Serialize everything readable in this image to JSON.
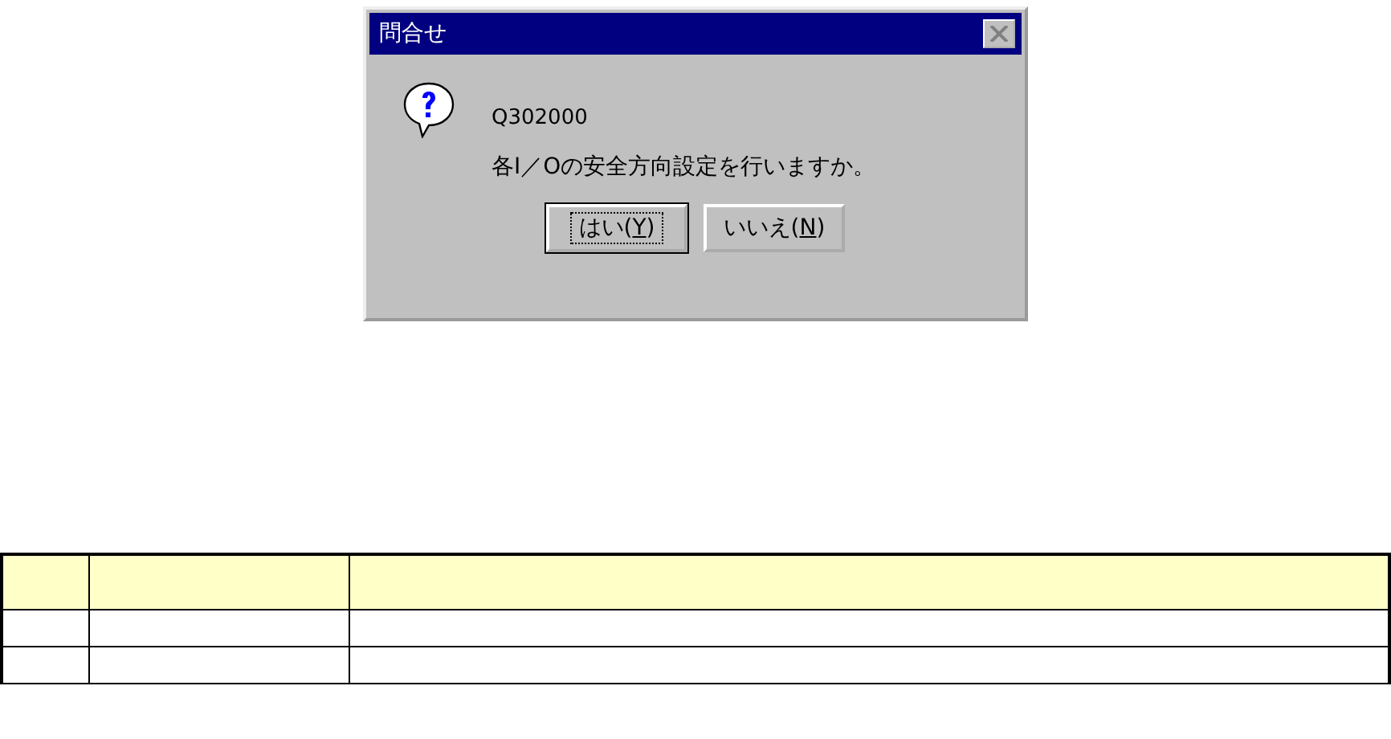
{
  "dialog": {
    "title": "問合せ",
    "message_code": "Q302000",
    "message": "各I／Oの安全方向設定を行いますか。",
    "buttons": [
      {
        "text": "はい(",
        "accesskey": "Y",
        "after": ")",
        "default": true
      },
      {
        "text": "いいえ(",
        "accesskey": "N",
        "after": ")",
        "default": false
      }
    ]
  }
}
